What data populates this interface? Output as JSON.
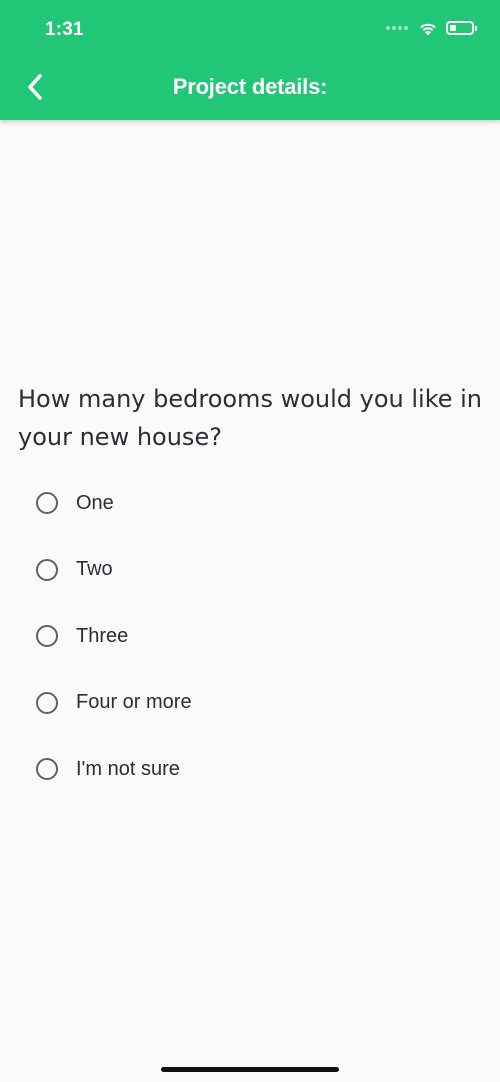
{
  "status_bar": {
    "time": "1:31",
    "icons": [
      "signal-icon",
      "wifi-icon",
      "battery-icon"
    ]
  },
  "app_bar": {
    "title": "Project details:",
    "back_icon": "chevron-left-icon",
    "background_color": "#21c676"
  },
  "question": {
    "text": "How many bedrooms would you like in your new house?"
  },
  "options": [
    {
      "label": "One",
      "selected": false
    },
    {
      "label": "Two",
      "selected": false
    },
    {
      "label": "Three",
      "selected": false
    },
    {
      "label": "Four or more",
      "selected": false
    },
    {
      "label": "I'm not sure",
      "selected": false
    }
  ]
}
